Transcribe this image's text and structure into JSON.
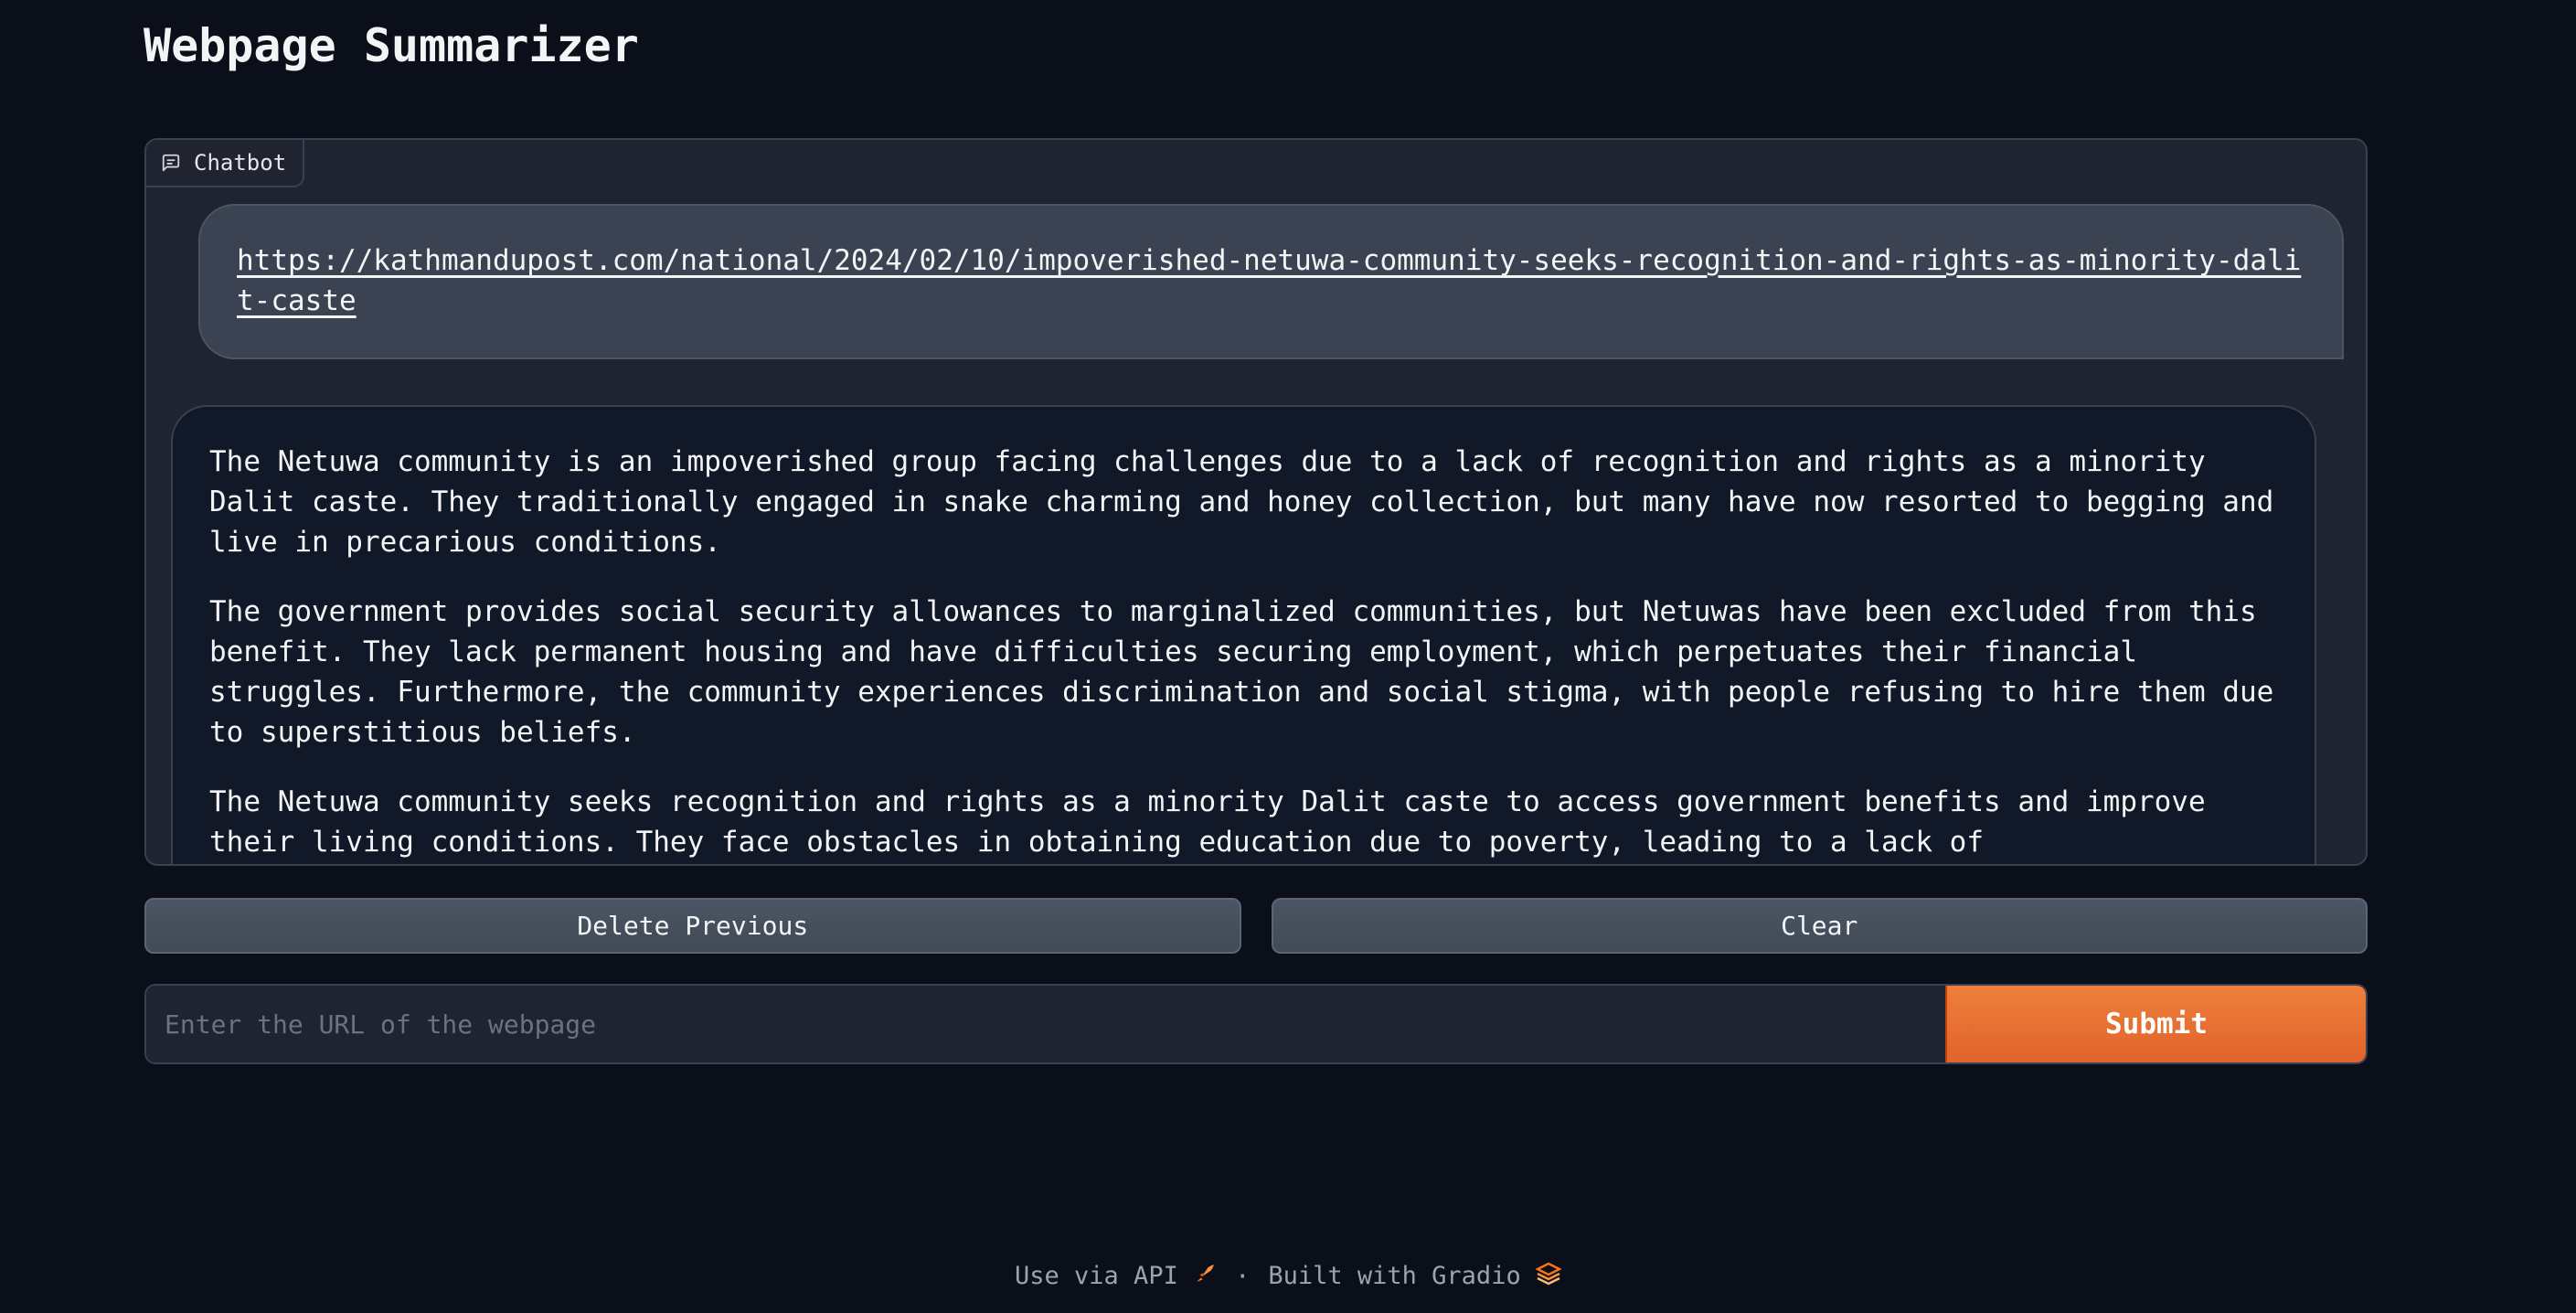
{
  "page": {
    "title": "Webpage Summarizer"
  },
  "chatbot": {
    "label": "Chatbot",
    "user_message": "https://kathmandupost.com/national/2024/02/10/impoverished-netuwa-community-seeks-recognition-and-rights-as-minority-dalit-caste",
    "bot_paragraphs": [
      "The Netuwa community is an impoverished group facing challenges due to a lack of recognition and rights as a minority Dalit caste. They traditionally engaged in snake charming and honey collection, but many have now resorted to begging and live in precarious conditions.",
      "The government provides social security allowances to marginalized communities, but Netuwas have been excluded from this benefit. They lack permanent housing and have difficulties securing employment, which perpetuates their financial struggles. Furthermore, the community experiences discrimination and social stigma, with people refusing to hire them due to superstitious beliefs.",
      "The Netuwa community seeks recognition and rights as a minority Dalit caste to access government benefits and improve their living conditions. They face obstacles in obtaining education due to poverty, leading to a lack of"
    ]
  },
  "buttons": {
    "delete_previous": "Delete Previous",
    "clear": "Clear",
    "submit": "Submit"
  },
  "input": {
    "placeholder": "Enter the URL of the webpage",
    "value": ""
  },
  "footer": {
    "api_link": "Use via API",
    "separator": "·",
    "built_with": "Built with Gradio"
  },
  "colors": {
    "background": "#0b0f19",
    "panel": "#1f2430",
    "accent": "#e8712f",
    "button": "#4b5563"
  },
  "icons": {
    "chatbot_label": "chat-bubble-icon",
    "api": "rocket-icon",
    "gradio": "gradio-logo-icon"
  }
}
